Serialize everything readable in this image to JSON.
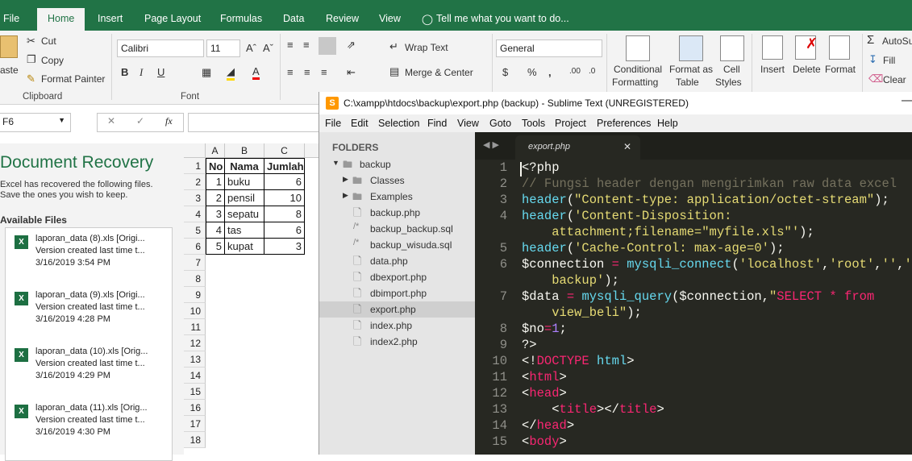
{
  "excel": {
    "tabs": [
      "File",
      "Home",
      "Insert",
      "Page Layout",
      "Formulas",
      "Data",
      "Review",
      "View"
    ],
    "tell_me": "Tell me what you want to do...",
    "clipboard": {
      "paste": "aste",
      "cut": "Cut",
      "copy": "Copy",
      "painter": "Format Painter",
      "group": "Clipboard"
    },
    "font": {
      "name": "Calibri",
      "size": "11",
      "group": "Font"
    },
    "alignment": {
      "wrap": "Wrap Text",
      "merge": "Merge & Center"
    },
    "number": {
      "format": "General"
    },
    "styles": {
      "cond1": "Conditional",
      "cond2": "Formatting",
      "fmt1": "Format as",
      "fmt2": "Table",
      "cell1": "Cell",
      "cell2": "Styles"
    },
    "cells": {
      "insert": "Insert",
      "delete": "Delete",
      "format": "Format"
    },
    "editing": {
      "autosum": "AutoSu",
      "fill": "Fill",
      "clear": "Clear"
    },
    "name_box": "F6",
    "doc_recovery": {
      "title": "Document Recovery",
      "desc1": "Excel has recovered the following files.",
      "desc2": "Save the ones you wish to keep.",
      "available": "Available Files",
      "files": [
        {
          "name": "laporan_data (8).xls  [Origi...",
          "ver": "Version created last time t...",
          "date": "3/16/2019 3:54 PM"
        },
        {
          "name": "laporan_data (9).xls  [Origi...",
          "ver": "Version created last time t...",
          "date": "3/16/2019 4:28 PM"
        },
        {
          "name": "laporan_data (10).xls  [Orig...",
          "ver": "Version created last time t...",
          "date": "3/16/2019 4:29 PM"
        },
        {
          "name": "laporan_data (11).xls  [Orig...",
          "ver": "Version created last time t...",
          "date": "3/16/2019 4:30 PM"
        }
      ]
    },
    "columns": [
      "A",
      "B",
      "C"
    ],
    "rows": [
      "1",
      "2",
      "3",
      "4",
      "5",
      "6",
      "7",
      "8",
      "9",
      "10",
      "11",
      "12",
      "13",
      "14",
      "15",
      "16",
      "17",
      "18"
    ],
    "table": {
      "header": [
        "No",
        "Nama",
        "Jumlah"
      ],
      "data": [
        [
          "1",
          "buku",
          "6"
        ],
        [
          "2",
          "pensil",
          "10"
        ],
        [
          "3",
          "sepatu",
          "8"
        ],
        [
          "4",
          "tas",
          "6"
        ],
        [
          "5",
          "kupat",
          "3"
        ]
      ]
    }
  },
  "sublime": {
    "title": "C:\\xampp\\htdocs\\backup\\export.php (backup) - Sublime Text (UNREGISTERED)",
    "menu": [
      "File",
      "Edit",
      "Selection",
      "Find",
      "View",
      "Goto",
      "Tools",
      "Project",
      "Preferences",
      "Help"
    ],
    "folders_label": "FOLDERS",
    "root": "backup",
    "dirs": [
      "Classes",
      "Examples"
    ],
    "files": [
      "backup.php",
      "backup_backup.sql",
      "backup_wisuda.sql",
      "data.php",
      "dbexport.php",
      "dbimport.php",
      "export.php",
      "index.php",
      "index2.php"
    ],
    "active_tab": "export.php",
    "line_numbers": [
      "1",
      "2",
      "3",
      "4",
      "",
      "5",
      "6",
      "",
      "7",
      "",
      "8",
      "9",
      "10",
      "11",
      "12",
      "13",
      "14",
      "15"
    ]
  },
  "colors": {
    "excel_green": "#217346",
    "editor_bg": "#272822",
    "keyword": "#f92672",
    "string": "#e6db74",
    "function": "#66d9ef",
    "comment": "#75715e",
    "number": "#ae81ff"
  }
}
